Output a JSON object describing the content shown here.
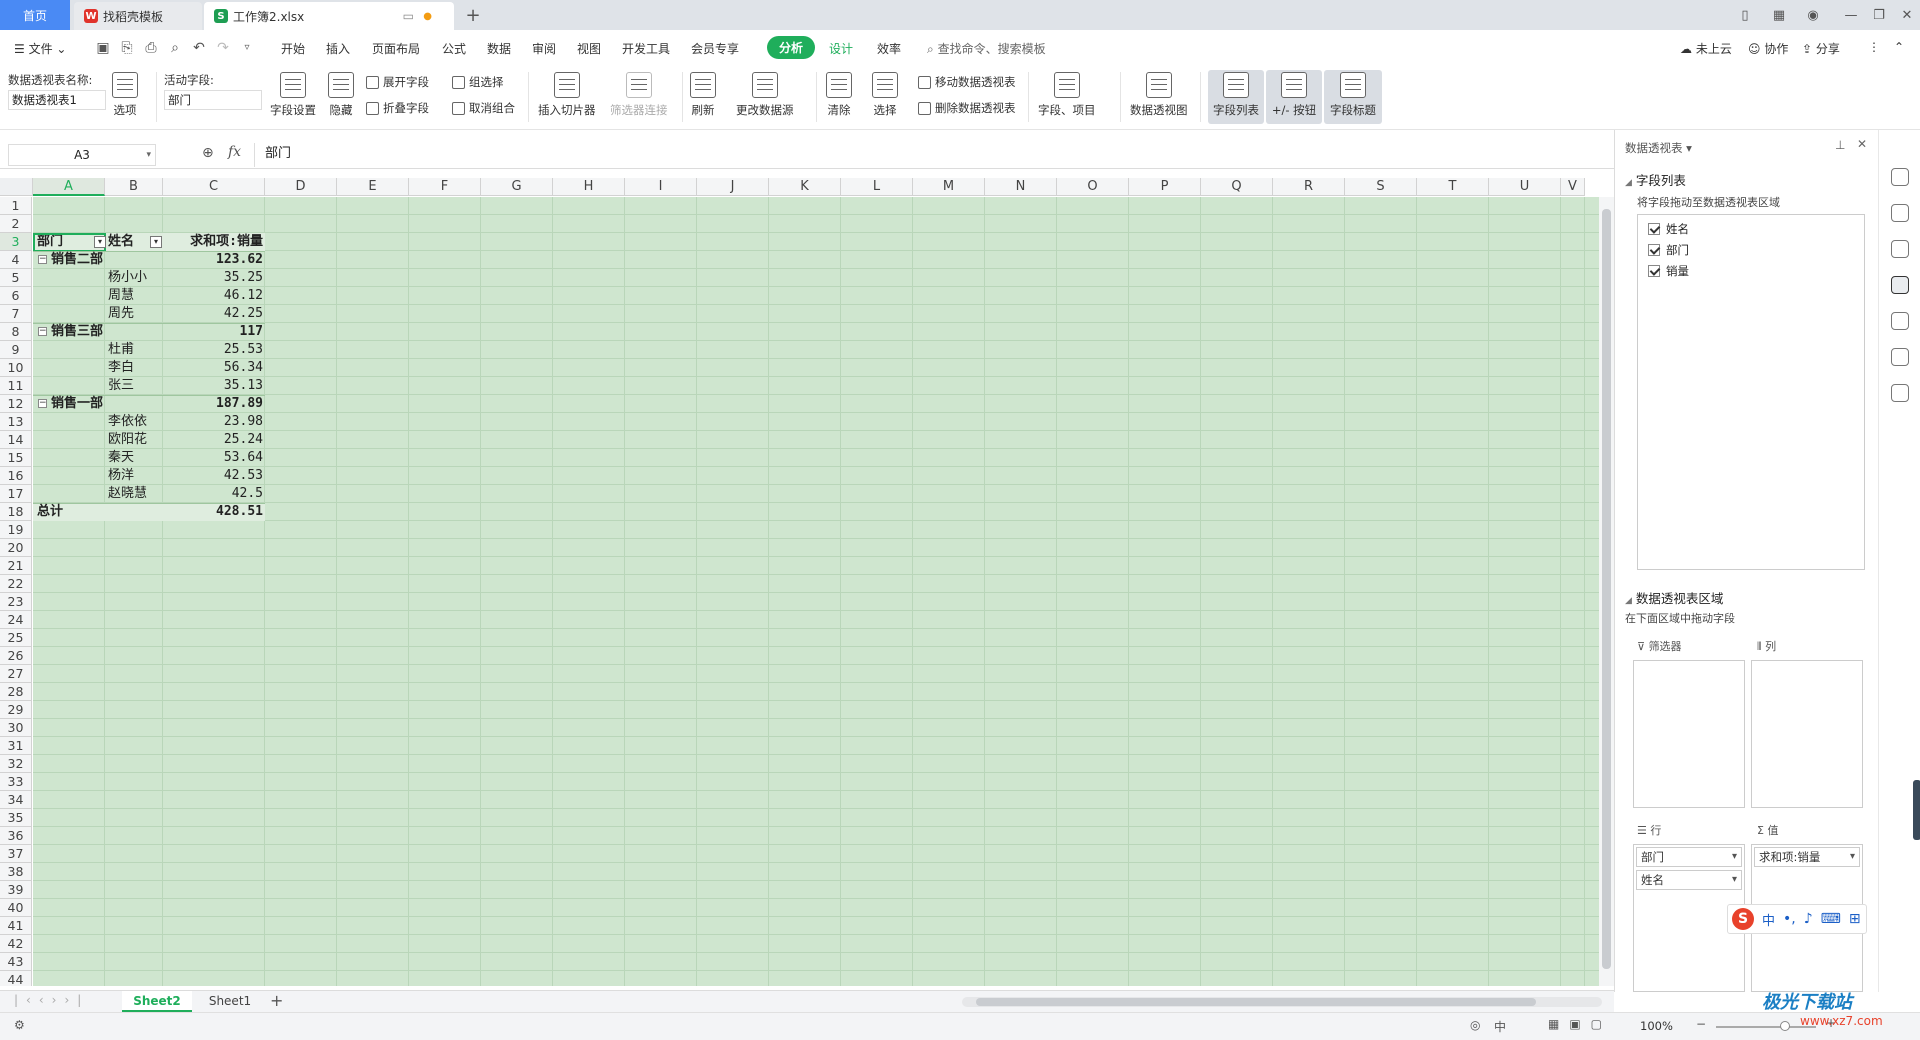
{
  "tabs": {
    "home": "首页",
    "template": "找稻壳模板",
    "workbook": "工作簿2.xlsx"
  },
  "menu": {
    "file": "文件",
    "items": [
      "开始",
      "插入",
      "页面布局",
      "公式",
      "数据",
      "审阅",
      "视图",
      "开发工具",
      "会员专享"
    ],
    "analysis": "分析",
    "design": "设计",
    "efficiency": "效率",
    "search_placeholder": "查找命令、搜索模板",
    "cloud": "未上云",
    "collab": "协作",
    "share": "分享"
  },
  "ribbon": {
    "pt_name_label": "数据透视表名称:",
    "pt_name_value": "数据透视表1",
    "options": "选项",
    "active_field_label": "活动字段:",
    "active_field_value": "部门",
    "field_settings": "字段设置",
    "hide": "隐藏",
    "expand": "展开字段",
    "collapse": "折叠字段",
    "group": "组选择",
    "ungroup": "取消组合",
    "insert_slicer": "插入切片器",
    "filter_connect": "筛选器连接",
    "refresh": "刷新",
    "change_source": "更改数据源",
    "clear": "清除",
    "select": "选择",
    "move_pt": "移动数据透视表",
    "delete_pt": "删除数据透视表",
    "fields_items": "字段、项目",
    "pivot_chart": "数据透视图",
    "field_list": "字段列表",
    "pm_buttons": "+/- 按钮",
    "field_headers": "字段标题"
  },
  "formula_bar": {
    "cell_ref": "A3",
    "fx": "fx",
    "content": "部门"
  },
  "columns": [
    "A",
    "B",
    "C",
    "D",
    "E",
    "F",
    "G",
    "H",
    "I",
    "J",
    "K",
    "L",
    "M",
    "N",
    "O",
    "P",
    "Q",
    "R",
    "S",
    "T",
    "U",
    "V"
  ],
  "rows": [
    "1",
    "2",
    "3",
    "4",
    "5",
    "6",
    "7",
    "8",
    "9",
    "10",
    "11",
    "12",
    "13",
    "14",
    "15",
    "16",
    "17",
    "18",
    "19",
    "20",
    "21",
    "22",
    "23",
    "24",
    "25",
    "26",
    "27",
    "28",
    "29",
    "30",
    "31",
    "32",
    "33",
    "34",
    "35",
    "36",
    "37",
    "38",
    "39",
    "40",
    "41",
    "42",
    "43",
    "44"
  ],
  "pivot": {
    "header": {
      "dept": "部门",
      "name": "姓名",
      "sum": "求和项:销量"
    },
    "rows": [
      {
        "level": "group",
        "label": "销售二部",
        "value": "123.62"
      },
      {
        "level": "item",
        "label": "杨小小",
        "value": "35.25"
      },
      {
        "level": "item",
        "label": "周慧",
        "value": "46.12"
      },
      {
        "level": "item",
        "label": "周先",
        "value": "42.25"
      },
      {
        "level": "group",
        "label": "销售三部",
        "value": "117"
      },
      {
        "level": "item",
        "label": "杜甫",
        "value": "25.53"
      },
      {
        "level": "item",
        "label": "李白",
        "value": "56.34"
      },
      {
        "level": "item",
        "label": "张三",
        "value": "35.13"
      },
      {
        "level": "group",
        "label": "销售一部",
        "value": "187.89"
      },
      {
        "level": "item",
        "label": "李依依",
        "value": "23.98"
      },
      {
        "level": "item",
        "label": "欧阳花",
        "value": "25.24"
      },
      {
        "level": "item",
        "label": "秦天",
        "value": "53.64"
      },
      {
        "level": "item",
        "label": "杨洋",
        "value": "42.53"
      },
      {
        "level": "item",
        "label": "赵晓慧",
        "value": "42.5"
      },
      {
        "level": "total",
        "label": "总计",
        "value": "428.51"
      }
    ]
  },
  "panel": {
    "title": "数据透视表",
    "field_list_title": "字段列表",
    "drag_hint": "将字段拖动至数据透视表区域",
    "fields": [
      "姓名",
      "部门",
      "销量"
    ],
    "area_title": "数据透视表区域",
    "area_hint": "在下面区域中拖动字段",
    "filter": "筛选器",
    "column": "列",
    "row": "行",
    "value": "值",
    "row_fields": [
      "部门",
      "姓名"
    ],
    "value_fields": [
      "求和项:销量"
    ]
  },
  "sheets": [
    "Sheet2",
    "Sheet1"
  ],
  "status": {
    "zoom": "100%",
    "ime": "中"
  },
  "watermark": "极光下载站",
  "watermark_url": "www.xz7.com"
}
